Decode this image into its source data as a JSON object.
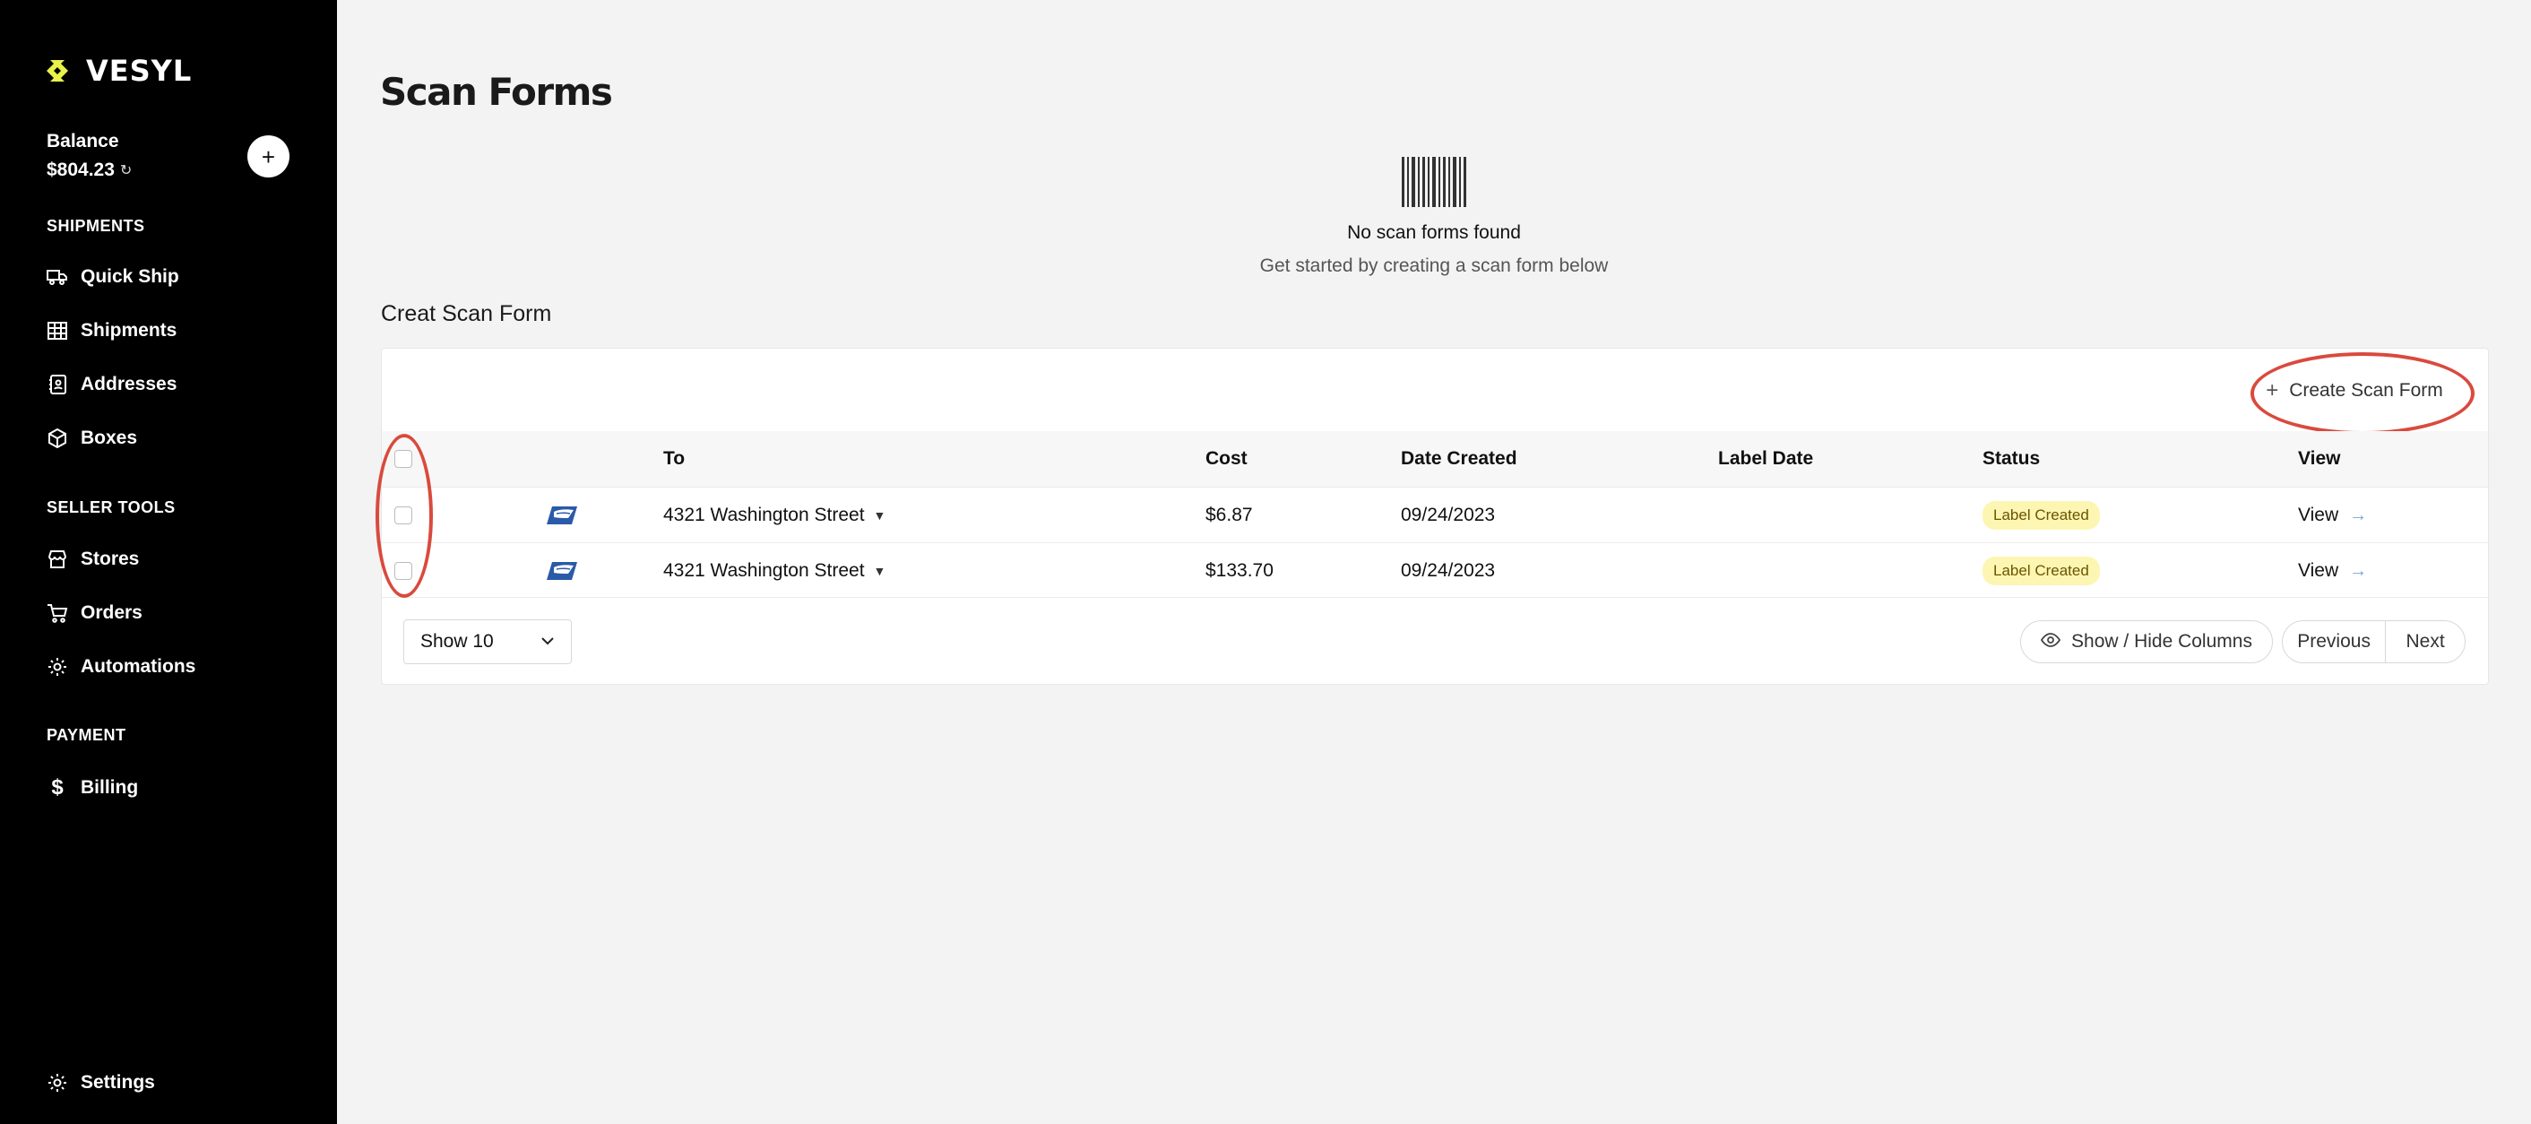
{
  "sidebar": {
    "logo_text": "VESYL",
    "balance_label": "Balance",
    "balance_amount": "$804.23",
    "add_label": "+",
    "sections": {
      "shipments": "SHIPMENTS",
      "seller_tools": "SELLER TOOLS",
      "payment": "PAYMENT"
    },
    "items": [
      {
        "label": "Quick Ship",
        "icon": "truck-icon"
      },
      {
        "label": "Shipments",
        "icon": "table-icon"
      },
      {
        "label": "Addresses",
        "icon": "address-book-icon"
      },
      {
        "label": "Boxes",
        "icon": "box-icon"
      },
      {
        "label": "Stores",
        "icon": "store-icon"
      },
      {
        "label": "Orders",
        "icon": "cart-icon"
      },
      {
        "label": "Automations",
        "icon": "gear-icon"
      },
      {
        "label": "Billing",
        "icon": "dollar-icon"
      },
      {
        "label": "Settings",
        "icon": "gear-icon"
      }
    ]
  },
  "main": {
    "title": "Scan Forms",
    "empty_title": "No scan forms found",
    "empty_subtitle": "Get started by creating a scan form below",
    "section_heading": "Creat Scan Form",
    "create_button": "Create Scan Form"
  },
  "table": {
    "headers": [
      "To",
      "Cost",
      "Date Created",
      "Label Date",
      "Status",
      "View"
    ],
    "rows": [
      {
        "carrier": "usps-icon",
        "to": "4321 Washington Street",
        "cost": "$6.87",
        "date_created": "09/24/2023",
        "label_date": "",
        "status": "Label Created",
        "view": "View"
      },
      {
        "carrier": "usps-icon",
        "to": "4321 Washington Street",
        "cost": "$133.70",
        "date_created": "09/24/2023",
        "label_date": "",
        "status": "Label Created",
        "view": "View"
      }
    ]
  },
  "footer": {
    "page_size": "Show 10",
    "columns_button": "Show / Hide Columns",
    "previous": "Previous",
    "next": "Next"
  },
  "colors": {
    "sidebar_bg": "#000000",
    "brand_yellow": "#e8f24a",
    "annotation_red": "#d94a3d",
    "badge_bg": "#fdf6b2",
    "usps_blue": "#2a5aa8"
  }
}
